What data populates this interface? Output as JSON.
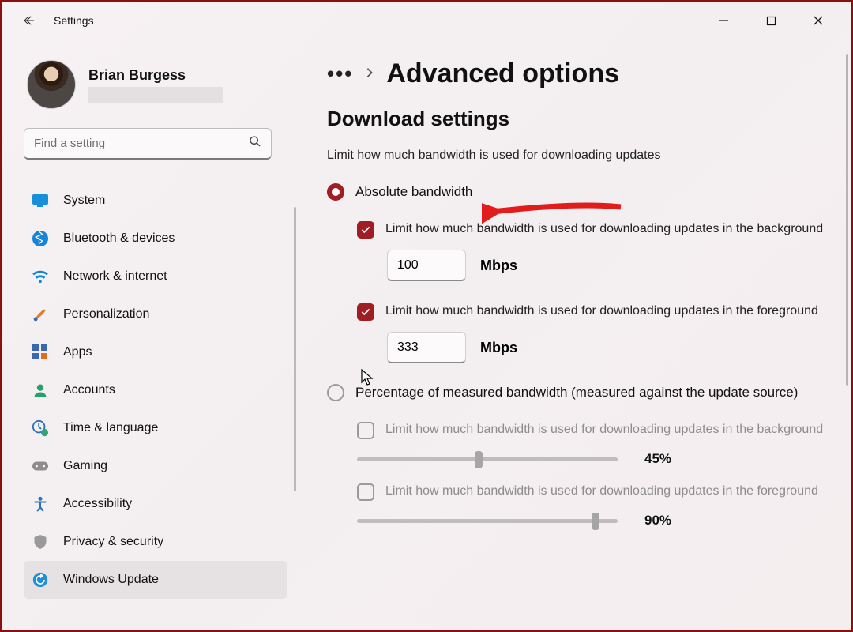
{
  "window": {
    "app_title": "Settings"
  },
  "profile": {
    "name": "Brian Burgess"
  },
  "search": {
    "placeholder": "Find a setting"
  },
  "sidebar": {
    "items": [
      {
        "label": "System"
      },
      {
        "label": "Bluetooth & devices"
      },
      {
        "label": "Network & internet"
      },
      {
        "label": "Personalization"
      },
      {
        "label": "Apps"
      },
      {
        "label": "Accounts"
      },
      {
        "label": "Time & language"
      },
      {
        "label": "Gaming"
      },
      {
        "label": "Accessibility"
      },
      {
        "label": "Privacy & security"
      },
      {
        "label": "Windows Update"
      }
    ]
  },
  "main": {
    "breadcrumb_title": "Advanced options",
    "section_title": "Download settings",
    "section_subtitle": "Limit how much bandwidth is used for downloading updates",
    "option_absolute": "Absolute bandwidth",
    "option_percentage": "Percentage of measured bandwidth (measured against the update source)",
    "bg_label": "Limit how much bandwidth is used for downloading updates in the background",
    "fg_label": "Limit how much bandwidth is used for downloading updates in the foreground",
    "bg_value": "100",
    "fg_value": "333",
    "unit": "Mbps",
    "pct_bg_value": "45%",
    "pct_fg_value": "90%"
  }
}
